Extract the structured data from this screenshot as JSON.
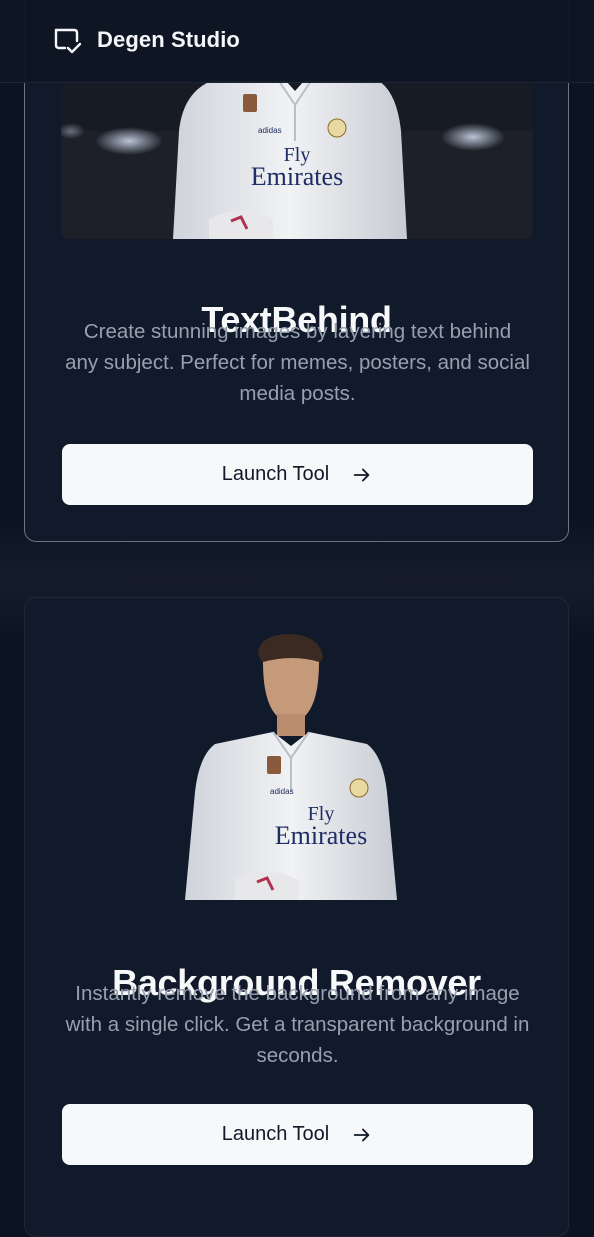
{
  "header": {
    "brand": "Degen Studio",
    "logo_icon": "chat-bubble-check-icon"
  },
  "tools": [
    {
      "title": "TextBehind",
      "description": "Create stunning images by layering text behind any subject. Perfect for memes, posters, and social media posts.",
      "button_label": "Launch Tool",
      "button_icon": "arrow-right-icon",
      "shirt_text": [
        "Fly",
        "Emirates"
      ]
    },
    {
      "title": "Background Remover",
      "description": "Instantly remove the background from any image with a single click. Get a transparent background in seconds.",
      "button_label": "Launch Tool",
      "button_icon": "arrow-right-icon",
      "shirt_text": [
        "Fly",
        "Emirates"
      ]
    }
  ],
  "colors": {
    "page_bg": "#0c1321",
    "card_bg": "#111a2b",
    "button_bg": "#f7f8fa",
    "text_primary": "#f7f8fa",
    "text_secondary": "#98a0af"
  }
}
